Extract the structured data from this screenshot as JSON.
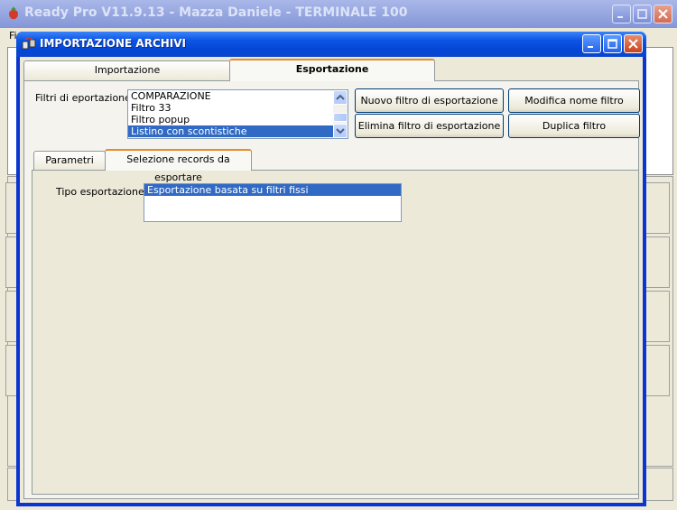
{
  "app": {
    "title": "Ready Pro V11.9.13 - Mazza Daniele - TERMINALE 100",
    "menu_first": "Fi"
  },
  "dialog": {
    "title": "IMPORTAZIONE ARCHIVI",
    "tabs": [
      {
        "label": "Importazione",
        "active": false
      },
      {
        "label": "Esportazione",
        "active": true
      }
    ],
    "export_filters": {
      "label": "Filtri di eportazione :",
      "items": [
        {
          "label": "COMPARAZIONE",
          "selected": false
        },
        {
          "label": "Filtro 33",
          "selected": false
        },
        {
          "label": "Filtro popup",
          "selected": false
        },
        {
          "label": "Listino con scontistiche",
          "selected": true
        }
      ]
    },
    "buttons": {
      "new_filter": "Nuovo filtro di esportazione",
      "rename_filter": "Modifica nome filtro",
      "delete_filter": "Elimina filtro di esportazione",
      "duplicate_filter": "Duplica filtro"
    },
    "sub_tabs": [
      {
        "label": "Parametri filtro",
        "active": false
      },
      {
        "label": "Selezione records da esportare",
        "active": true
      }
    ],
    "export_type": {
      "label": "Tipo esportazione :",
      "items": [
        {
          "label": "Esportazione basata su filtri fissi",
          "selected": true
        }
      ]
    }
  },
  "colors": {
    "title_active": "#0a46cc",
    "title_inactive": "#8496d8",
    "selection": "#316ac5",
    "face": "#ece9d8"
  }
}
